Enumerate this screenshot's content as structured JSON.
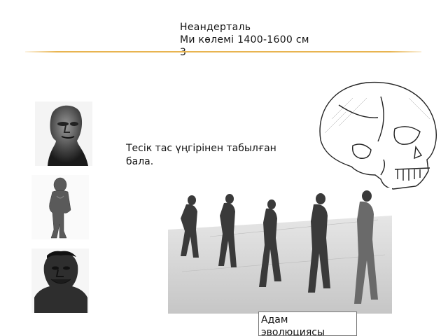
{
  "slide": {
    "title_lines": [
      "Неандерталь",
      "Ми көлемі 1400-1600 см",
      "3"
    ],
    "caption_lines": [
      "Тесік тас үңгірінен табылған",
      "бала."
    ],
    "box_lines": [
      "Адам",
      "эволюциясы"
    ]
  },
  "images": {
    "bust_1": "neanderthal-head-bust",
    "child": "child-figure-statue",
    "bust_2": "neanderthal-bust-2",
    "skull": "skull-drawing",
    "evolution": "human-evolution-scene"
  },
  "colors": {
    "rule": "#e8b450",
    "ink": "#111111"
  }
}
